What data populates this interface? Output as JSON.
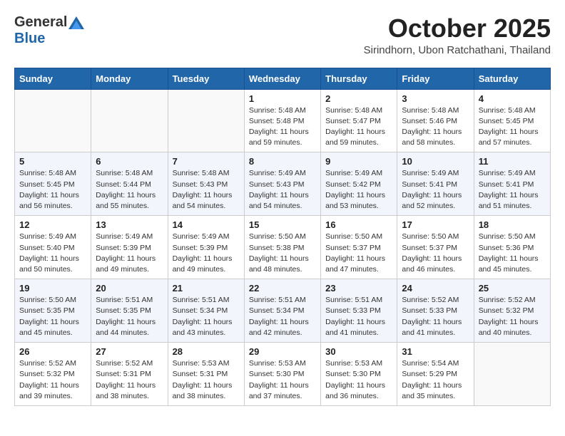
{
  "logo": {
    "line1": "General",
    "line2": "Blue"
  },
  "title": "October 2025",
  "subtitle": "Sirindhorn, Ubon Ratchathani, Thailand",
  "weekdays": [
    "Sunday",
    "Monday",
    "Tuesday",
    "Wednesday",
    "Thursday",
    "Friday",
    "Saturday"
  ],
  "weeks": [
    [
      {
        "day": "",
        "sunrise": "",
        "sunset": "",
        "daylight": ""
      },
      {
        "day": "",
        "sunrise": "",
        "sunset": "",
        "daylight": ""
      },
      {
        "day": "",
        "sunrise": "",
        "sunset": "",
        "daylight": ""
      },
      {
        "day": "1",
        "sunrise": "Sunrise: 5:48 AM",
        "sunset": "Sunset: 5:48 PM",
        "daylight": "Daylight: 11 hours and 59 minutes."
      },
      {
        "day": "2",
        "sunrise": "Sunrise: 5:48 AM",
        "sunset": "Sunset: 5:47 PM",
        "daylight": "Daylight: 11 hours and 59 minutes."
      },
      {
        "day": "3",
        "sunrise": "Sunrise: 5:48 AM",
        "sunset": "Sunset: 5:46 PM",
        "daylight": "Daylight: 11 hours and 58 minutes."
      },
      {
        "day": "4",
        "sunrise": "Sunrise: 5:48 AM",
        "sunset": "Sunset: 5:45 PM",
        "daylight": "Daylight: 11 hours and 57 minutes."
      }
    ],
    [
      {
        "day": "5",
        "sunrise": "Sunrise: 5:48 AM",
        "sunset": "Sunset: 5:45 PM",
        "daylight": "Daylight: 11 hours and 56 minutes."
      },
      {
        "day": "6",
        "sunrise": "Sunrise: 5:48 AM",
        "sunset": "Sunset: 5:44 PM",
        "daylight": "Daylight: 11 hours and 55 minutes."
      },
      {
        "day": "7",
        "sunrise": "Sunrise: 5:48 AM",
        "sunset": "Sunset: 5:43 PM",
        "daylight": "Daylight: 11 hours and 54 minutes."
      },
      {
        "day": "8",
        "sunrise": "Sunrise: 5:49 AM",
        "sunset": "Sunset: 5:43 PM",
        "daylight": "Daylight: 11 hours and 54 minutes."
      },
      {
        "day": "9",
        "sunrise": "Sunrise: 5:49 AM",
        "sunset": "Sunset: 5:42 PM",
        "daylight": "Daylight: 11 hours and 53 minutes."
      },
      {
        "day": "10",
        "sunrise": "Sunrise: 5:49 AM",
        "sunset": "Sunset: 5:41 PM",
        "daylight": "Daylight: 11 hours and 52 minutes."
      },
      {
        "day": "11",
        "sunrise": "Sunrise: 5:49 AM",
        "sunset": "Sunset: 5:41 PM",
        "daylight": "Daylight: 11 hours and 51 minutes."
      }
    ],
    [
      {
        "day": "12",
        "sunrise": "Sunrise: 5:49 AM",
        "sunset": "Sunset: 5:40 PM",
        "daylight": "Daylight: 11 hours and 50 minutes."
      },
      {
        "day": "13",
        "sunrise": "Sunrise: 5:49 AM",
        "sunset": "Sunset: 5:39 PM",
        "daylight": "Daylight: 11 hours and 49 minutes."
      },
      {
        "day": "14",
        "sunrise": "Sunrise: 5:49 AM",
        "sunset": "Sunset: 5:39 PM",
        "daylight": "Daylight: 11 hours and 49 minutes."
      },
      {
        "day": "15",
        "sunrise": "Sunrise: 5:50 AM",
        "sunset": "Sunset: 5:38 PM",
        "daylight": "Daylight: 11 hours and 48 minutes."
      },
      {
        "day": "16",
        "sunrise": "Sunrise: 5:50 AM",
        "sunset": "Sunset: 5:37 PM",
        "daylight": "Daylight: 11 hours and 47 minutes."
      },
      {
        "day": "17",
        "sunrise": "Sunrise: 5:50 AM",
        "sunset": "Sunset: 5:37 PM",
        "daylight": "Daylight: 11 hours and 46 minutes."
      },
      {
        "day": "18",
        "sunrise": "Sunrise: 5:50 AM",
        "sunset": "Sunset: 5:36 PM",
        "daylight": "Daylight: 11 hours and 45 minutes."
      }
    ],
    [
      {
        "day": "19",
        "sunrise": "Sunrise: 5:50 AM",
        "sunset": "Sunset: 5:35 PM",
        "daylight": "Daylight: 11 hours and 45 minutes."
      },
      {
        "day": "20",
        "sunrise": "Sunrise: 5:51 AM",
        "sunset": "Sunset: 5:35 PM",
        "daylight": "Daylight: 11 hours and 44 minutes."
      },
      {
        "day": "21",
        "sunrise": "Sunrise: 5:51 AM",
        "sunset": "Sunset: 5:34 PM",
        "daylight": "Daylight: 11 hours and 43 minutes."
      },
      {
        "day": "22",
        "sunrise": "Sunrise: 5:51 AM",
        "sunset": "Sunset: 5:34 PM",
        "daylight": "Daylight: 11 hours and 42 minutes."
      },
      {
        "day": "23",
        "sunrise": "Sunrise: 5:51 AM",
        "sunset": "Sunset: 5:33 PM",
        "daylight": "Daylight: 11 hours and 41 minutes."
      },
      {
        "day": "24",
        "sunrise": "Sunrise: 5:52 AM",
        "sunset": "Sunset: 5:33 PM",
        "daylight": "Daylight: 11 hours and 41 minutes."
      },
      {
        "day": "25",
        "sunrise": "Sunrise: 5:52 AM",
        "sunset": "Sunset: 5:32 PM",
        "daylight": "Daylight: 11 hours and 40 minutes."
      }
    ],
    [
      {
        "day": "26",
        "sunrise": "Sunrise: 5:52 AM",
        "sunset": "Sunset: 5:32 PM",
        "daylight": "Daylight: 11 hours and 39 minutes."
      },
      {
        "day": "27",
        "sunrise": "Sunrise: 5:52 AM",
        "sunset": "Sunset: 5:31 PM",
        "daylight": "Daylight: 11 hours and 38 minutes."
      },
      {
        "day": "28",
        "sunrise": "Sunrise: 5:53 AM",
        "sunset": "Sunset: 5:31 PM",
        "daylight": "Daylight: 11 hours and 38 minutes."
      },
      {
        "day": "29",
        "sunrise": "Sunrise: 5:53 AM",
        "sunset": "Sunset: 5:30 PM",
        "daylight": "Daylight: 11 hours and 37 minutes."
      },
      {
        "day": "30",
        "sunrise": "Sunrise: 5:53 AM",
        "sunset": "Sunset: 5:30 PM",
        "daylight": "Daylight: 11 hours and 36 minutes."
      },
      {
        "day": "31",
        "sunrise": "Sunrise: 5:54 AM",
        "sunset": "Sunset: 5:29 PM",
        "daylight": "Daylight: 11 hours and 35 minutes."
      },
      {
        "day": "",
        "sunrise": "",
        "sunset": "",
        "daylight": ""
      }
    ]
  ]
}
